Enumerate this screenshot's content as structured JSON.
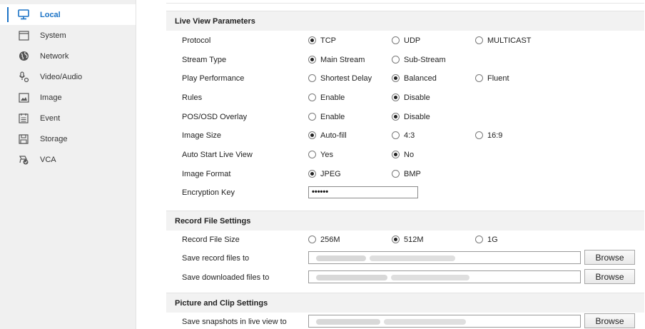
{
  "sidebar": {
    "items": [
      {
        "label": "Local",
        "icon": "monitor-icon",
        "active": true
      },
      {
        "label": "System",
        "icon": "system-window-icon",
        "active": false
      },
      {
        "label": "Network",
        "icon": "globe-icon",
        "active": false
      },
      {
        "label": "Video/Audio",
        "icon": "microphone-camera-icon",
        "active": false
      },
      {
        "label": "Image",
        "icon": "image-icon",
        "active": false
      },
      {
        "label": "Event",
        "icon": "calendar-icon",
        "active": false
      },
      {
        "label": "Storage",
        "icon": "floppy-disk-icon",
        "active": false
      },
      {
        "label": "VCA",
        "icon": "vca-camera-icon",
        "active": false
      }
    ]
  },
  "live_view": {
    "title": "Live View Parameters",
    "protocol": {
      "label": "Protocol",
      "options": [
        "TCP",
        "UDP",
        "MULTICAST"
      ],
      "selected": "TCP"
    },
    "stream_type": {
      "label": "Stream Type",
      "options": [
        "Main Stream",
        "Sub-Stream"
      ],
      "selected": "Main Stream"
    },
    "play_performance": {
      "label": "Play Performance",
      "options": [
        "Shortest Delay",
        "Balanced",
        "Fluent"
      ],
      "selected": "Balanced"
    },
    "rules": {
      "label": "Rules",
      "options": [
        "Enable",
        "Disable"
      ],
      "selected": "Disable"
    },
    "pos_osd": {
      "label": "POS/OSD Overlay",
      "options": [
        "Enable",
        "Disable"
      ],
      "selected": "Disable"
    },
    "image_size": {
      "label": "Image Size",
      "options": [
        "Auto-fill",
        "4:3",
        "16:9"
      ],
      "selected": "Auto-fill"
    },
    "auto_start": {
      "label": "Auto Start Live View",
      "options": [
        "Yes",
        "No"
      ],
      "selected": "No"
    },
    "image_format": {
      "label": "Image Format",
      "options": [
        "JPEG",
        "BMP"
      ],
      "selected": "JPEG"
    },
    "encryption_key": {
      "label": "Encryption Key",
      "value": "••••••"
    }
  },
  "record_file": {
    "title": "Record File Settings",
    "record_file_size": {
      "label": "Record File Size",
      "options": [
        "256M",
        "512M",
        "1G"
      ],
      "selected": "512M"
    },
    "save_record": {
      "label": "Save record files to",
      "button": "Browse"
    },
    "save_downloaded": {
      "label": "Save downloaded files to",
      "button": "Browse"
    }
  },
  "picture_clip": {
    "title": "Picture and Clip Settings",
    "save_snapshots": {
      "label": "Save snapshots in live view to",
      "button": "Browse"
    }
  },
  "colors": {
    "accent": "#1b73c6",
    "sidebar_bg": "#f0f0f0",
    "header_bg": "#f2f2f2"
  }
}
